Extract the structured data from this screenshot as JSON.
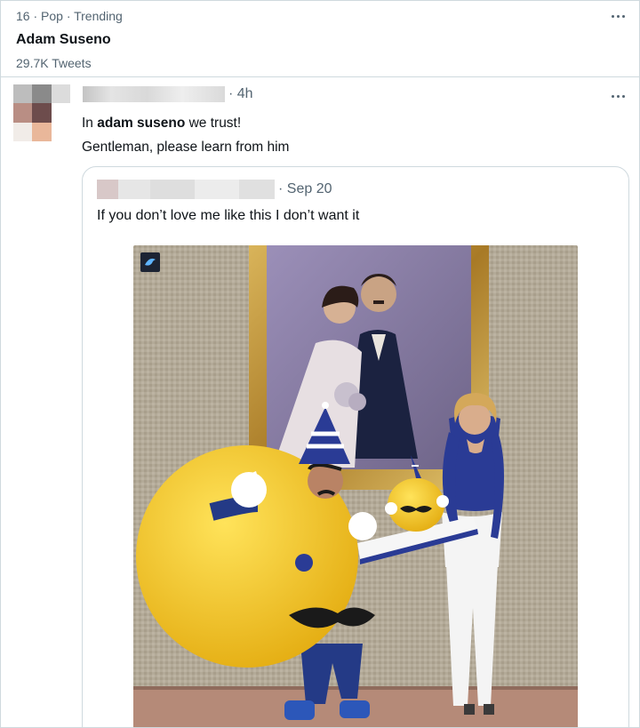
{
  "trend": {
    "meta": "16 · Pop · Trending",
    "title": "Adam Suseno",
    "count": "29.7K Tweets"
  },
  "tweet": {
    "time": "· 4h",
    "text_prefix": "In ",
    "text_bold": "adam suseno",
    "text_suffix": " we trust!",
    "text_line2": "Gentleman, please learn from him"
  },
  "quoted": {
    "time": "· Sep 20",
    "text": "If you don’t love me like this I don’t want it"
  },
  "colors": {
    "text": "#0f1419",
    "secondary": "#536471",
    "border": "#cfd9de",
    "mascot_yellow": "#f2c92c",
    "mascot_blue": "#1f3b8f"
  },
  "icons": {
    "more": "more-horizontal-icon",
    "watermark": "bird-logo-icon"
  }
}
